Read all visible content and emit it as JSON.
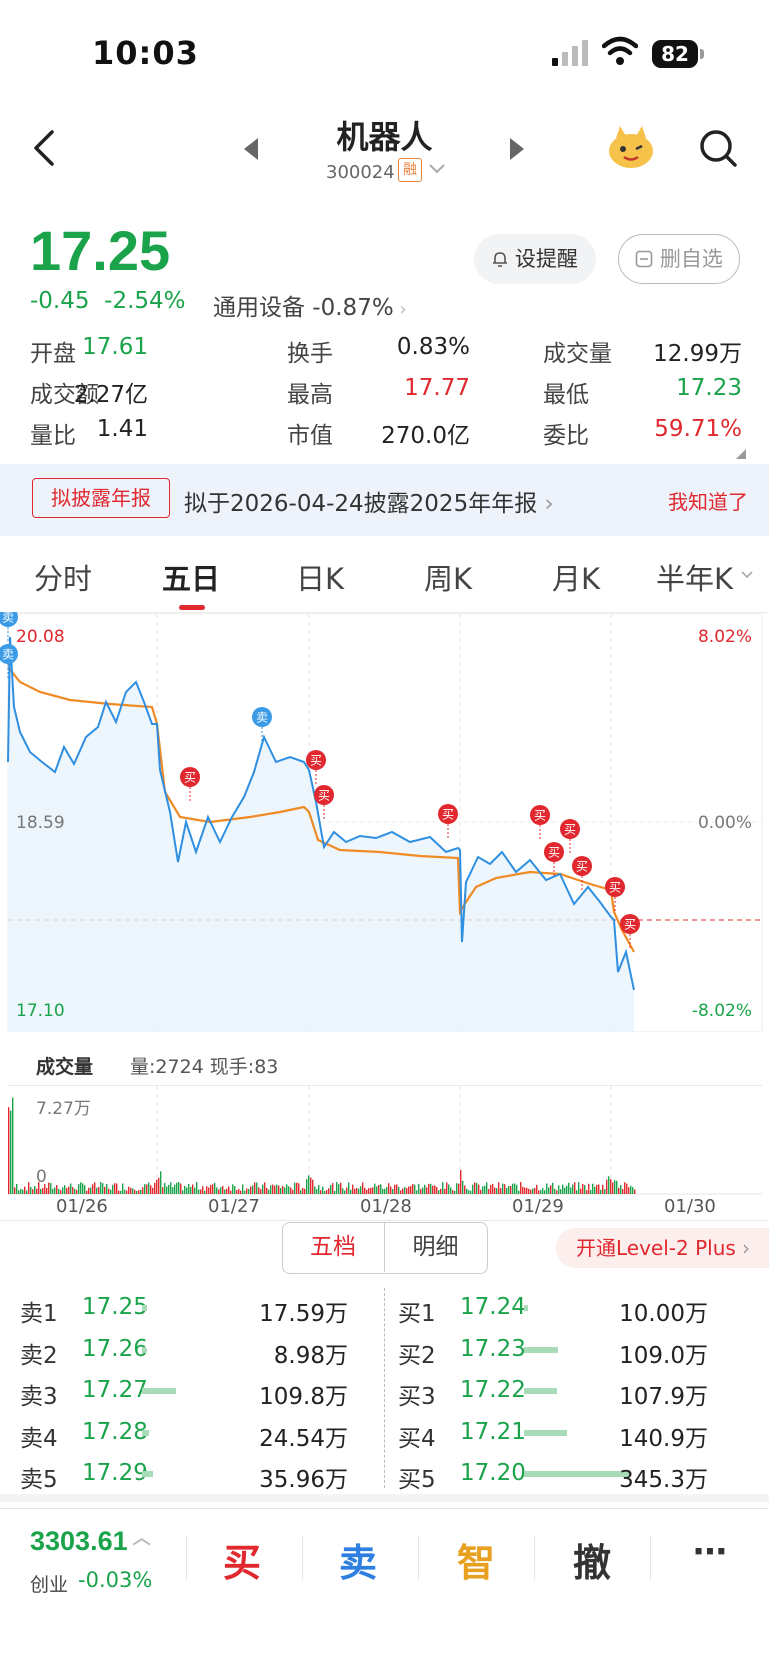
{
  "status": {
    "time": "10:03",
    "battery": "82"
  },
  "header": {
    "title": "机器人",
    "code": "300024",
    "margin_badge": "融"
  },
  "quote": {
    "price": "17.25",
    "change": "-0.45",
    "change_pct": "-2.54%",
    "sector": "通用设备 -0.87%",
    "remind_label": "设提醒",
    "delete_label": "删自选"
  },
  "stats": [
    [
      {
        "k": "开盘",
        "v": "17.61",
        "c": "green"
      },
      {
        "k": "换手",
        "v": "0.83%",
        "c": "dark"
      },
      {
        "k": "成交量",
        "v": "12.99万",
        "c": "dark"
      }
    ],
    [
      {
        "k": "成交额",
        "v": "2.27亿",
        "c": "dark"
      },
      {
        "k": "最高",
        "v": "17.77",
        "c": "red"
      },
      {
        "k": "最低",
        "v": "17.23",
        "c": "green"
      }
    ],
    [
      {
        "k": "量比",
        "v": "1.41",
        "c": "dark"
      },
      {
        "k": "市值",
        "v": "270.0亿",
        "c": "dark"
      },
      {
        "k": "委比",
        "v": "59.71%",
        "c": "red"
      }
    ]
  ],
  "banner": {
    "tag": "拟披露年报",
    "text": "拟于2026-04-24披露2025年年报",
    "dismiss": "我知道了"
  },
  "tabs": [
    "分时",
    "五日",
    "日K",
    "周K",
    "月K",
    "半年K"
  ],
  "active_tab": "五日",
  "chart": {
    "y_high": "20.08",
    "y_mid": "18.59",
    "y_low": "17.10",
    "pct_high": "8.02%",
    "pct_mid": "0.00%",
    "pct_low": "-8.02%",
    "dates": [
      "01/26",
      "01/27",
      "01/28",
      "01/29",
      "01/30"
    ],
    "buy_mark": "买",
    "sell_mark": "卖"
  },
  "volume": {
    "label": "成交量",
    "info": "量:2724 现手:83",
    "max": "7.27万",
    "min": "0"
  },
  "book": {
    "tab_a": "五档",
    "tab_b": "明细",
    "level2": "开通Level-2 Plus",
    "asks": [
      {
        "name": "卖1",
        "price": "17.25",
        "vol": "17.59万",
        "bar": 0.05
      },
      {
        "name": "卖2",
        "price": "17.26",
        "vol": "8.98万",
        "bar": 0.03
      },
      {
        "name": "卖3",
        "price": "17.27",
        "vol": "109.8万",
        "bar": 0.32
      },
      {
        "name": "卖4",
        "price": "17.28",
        "vol": "24.54万",
        "bar": 0.07
      },
      {
        "name": "卖5",
        "price": "17.29",
        "vol": "35.96万",
        "bar": 0.1
      }
    ],
    "bids": [
      {
        "name": "买1",
        "price": "17.24",
        "vol": "10.00万",
        "bar": 0.03
      },
      {
        "name": "买2",
        "price": "17.23",
        "vol": "109.0万",
        "bar": 0.32
      },
      {
        "name": "买3",
        "price": "17.22",
        "vol": "107.9万",
        "bar": 0.31
      },
      {
        "name": "买4",
        "price": "17.21",
        "vol": "140.9万",
        "bar": 0.41
      },
      {
        "name": "买5",
        "price": "17.20",
        "vol": "345.3万",
        "bar": 1.0
      }
    ]
  },
  "bottom": {
    "index_value": "3303.61",
    "index_name": "创业",
    "index_chg": "-0.03%",
    "buy": "买",
    "sell": "卖",
    "smart": "智",
    "cancel": "撤",
    "more": "⋯"
  },
  "colors": {
    "up": "#e0282e",
    "down": "#1aa34a",
    "line": "#2f8fe0",
    "avg": "#f08a24"
  }
}
